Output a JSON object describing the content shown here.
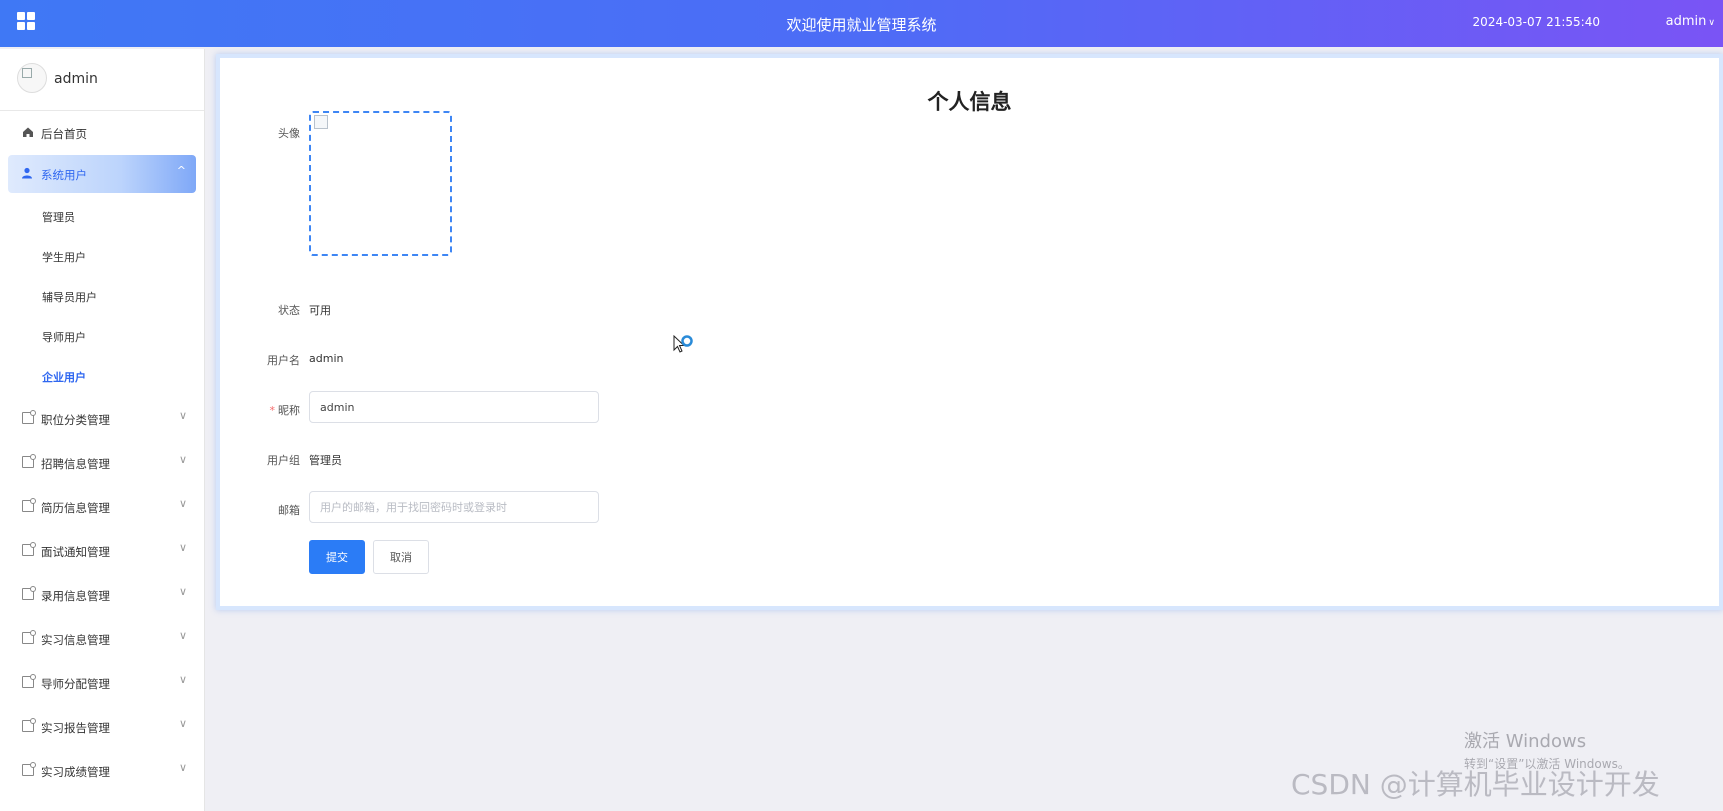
{
  "header": {
    "title": "欢迎使用就业管理系统",
    "datetime": "2024-03-07 21:55:40",
    "user": "admin"
  },
  "sidebar": {
    "profile_name": "admin",
    "items": [
      {
        "label": "后台首页"
      },
      {
        "label": "系统用户",
        "expanded": true,
        "children": [
          "管理员",
          "学生用户",
          "辅导员用户",
          "导师用户",
          "企业用户"
        ]
      },
      {
        "label": "职位分类管理"
      },
      {
        "label": "招聘信息管理"
      },
      {
        "label": "简历信息管理"
      },
      {
        "label": "面试通知管理"
      },
      {
        "label": "录用信息管理"
      },
      {
        "label": "实习信息管理"
      },
      {
        "label": "导师分配管理"
      },
      {
        "label": "实习报告管理"
      },
      {
        "label": "实习成绩管理"
      }
    ]
  },
  "form": {
    "title": "个人信息",
    "avatar_label": "头像",
    "status_label": "状态",
    "status_value": "可用",
    "username_label": "用户名",
    "username_value": "admin",
    "nickname_label": "昵称",
    "nickname_value": "admin",
    "group_label": "用户组",
    "group_value": "管理员",
    "email_label": "邮箱",
    "email_placeholder": "用户的邮箱，用于找回密码时或登录时",
    "submit_label": "提交",
    "cancel_label": "取消"
  },
  "overlays": {
    "windows_activate_line1": "激活 Windows",
    "windows_activate_line2": "转到“设置”以激活 Windows。",
    "watermark": "CSDN @计算机毕业设计开发"
  },
  "colors": {
    "accent": "#2b7cf6",
    "header_gradient_start": "#3f78f5",
    "header_gradient_end": "#7a54f5"
  }
}
